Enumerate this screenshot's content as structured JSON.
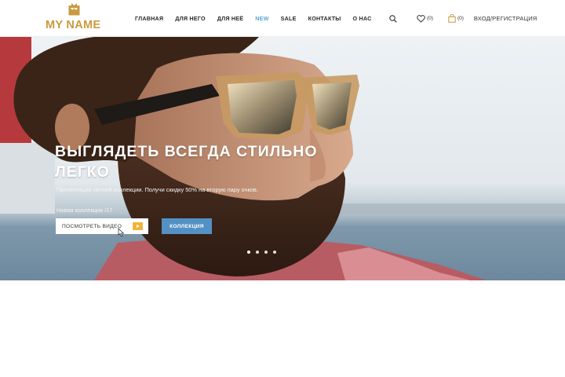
{
  "brand": {
    "name": "MY NAME",
    "color": "#c99a3f",
    "icon": "crown-frame-icon"
  },
  "nav": [
    {
      "id": "home",
      "label": "ГЛАВНАЯ"
    },
    {
      "id": "him",
      "label": "ДЛЯ НЕГО"
    },
    {
      "id": "her",
      "label": "ДЛЯ НЕЁ"
    },
    {
      "id": "new",
      "label": "NEW",
      "accent": "#5aa6d6"
    },
    {
      "id": "sale",
      "label": "SALE"
    },
    {
      "id": "contacts",
      "label": "КОНТАКТЫ"
    },
    {
      "id": "about",
      "label": "О НАС"
    }
  ],
  "tools": {
    "search_icon": "search-icon",
    "wishlist": {
      "icon": "heart-icon",
      "count": "(0)"
    },
    "cart": {
      "icon": "bag-icon",
      "count": "(0)"
    },
    "auth": "ВХОД/РЕГИСТРАЦИЯ"
  },
  "hero": {
    "title_line1": "ВЫГЛЯДЕТЬ ВСЕГДА СТИЛЬНО",
    "title_line2": "ЛЕГКО",
    "subtitle": "Презентация летней коллекции. Получи скидку 50% на вторую пару очков.",
    "collection": "Новая коллекция /17",
    "btn_video": "ПОСМОТРЕТЬ ВИДЕО",
    "btn_collection": "КОЛЛЕКЦИЯ",
    "slides": 4,
    "active_slide": 0,
    "button_color": "#5391c4",
    "play_color": "#f0b43c"
  }
}
